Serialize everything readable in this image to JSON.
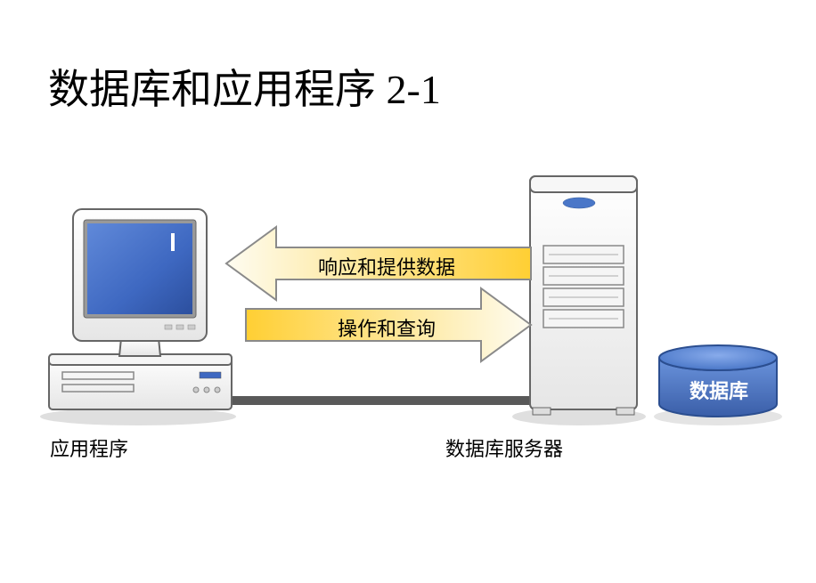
{
  "title": "数据库和应用程序 2-1",
  "arrows": {
    "response": "响应和提供数据",
    "request": "操作和查询"
  },
  "labels": {
    "client": "应用程序",
    "server": "数据库服务器",
    "db": "数据库"
  },
  "colors": {
    "arrowFill1": "#ffcf33",
    "arrowFill2": "#fefcf1",
    "arrowStroke": "#8a8a8a",
    "monitorScreen": "#3e68c1",
    "deviceBody": "#fdfdfd",
    "deviceStroke": "#666666",
    "dbBlue": "#4a77c8",
    "shadow": "#c9c9c9",
    "connector": "#595959"
  }
}
